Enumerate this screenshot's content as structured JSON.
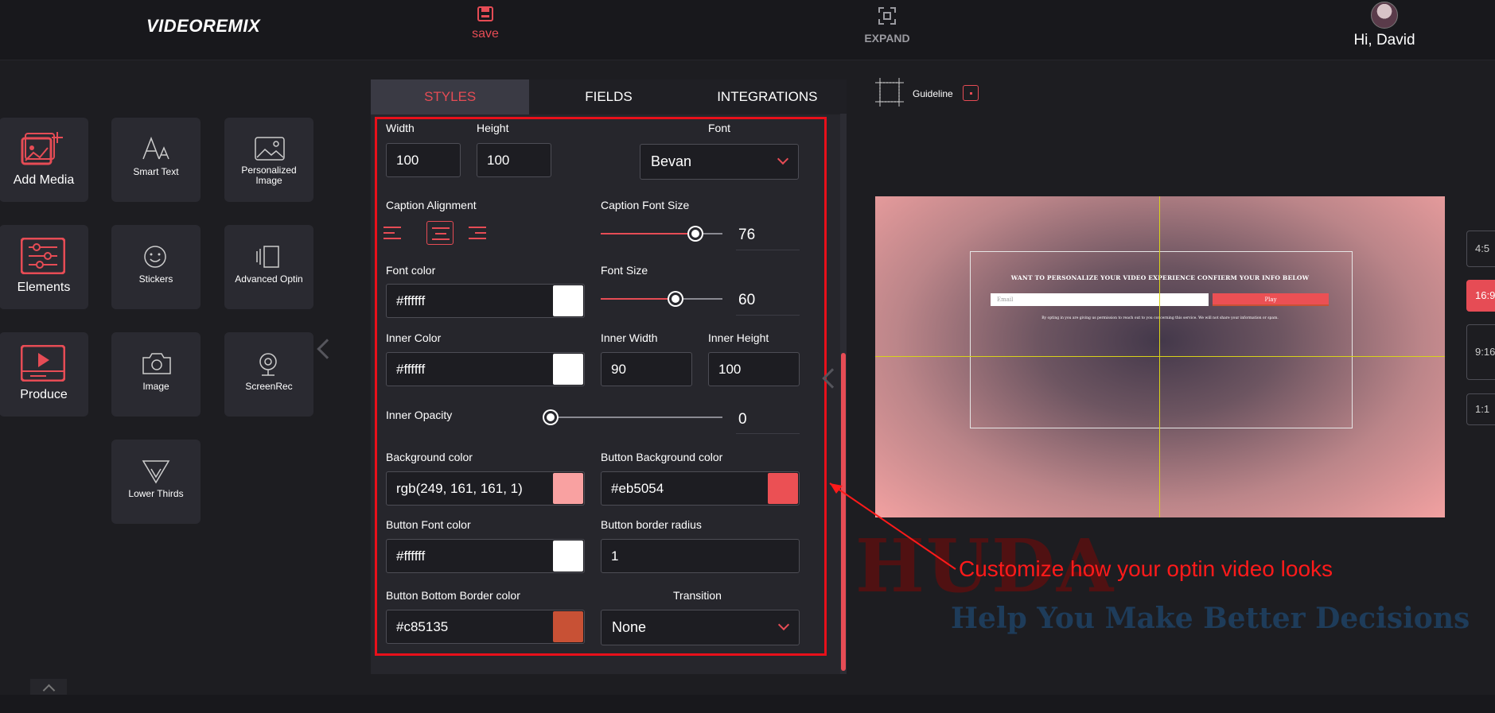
{
  "header": {
    "logo": "VIDEOREMIX",
    "save_label": "save",
    "expand_label": "EXPAND",
    "greeting": "Hi, David"
  },
  "media_menu": [
    {
      "label": "Add Media",
      "icon": "add-media-icon"
    },
    {
      "label": "Elements",
      "icon": "elements-icon"
    },
    {
      "label": "Produce",
      "icon": "produce-icon"
    }
  ],
  "tools": [
    {
      "label": "Smart Text",
      "icon": "smart-text-icon"
    },
    {
      "label": "Personalized Image",
      "icon": "personalized-image-icon"
    },
    {
      "label": "Stickers",
      "icon": "stickers-icon"
    },
    {
      "label": "Advanced Optin",
      "icon": "advanced-optin-icon"
    },
    {
      "label": "Image",
      "icon": "camera-icon"
    },
    {
      "label": "ScreenRec",
      "icon": "webcam-icon"
    },
    {
      "label": "Lower Thirds",
      "icon": "lower-thirds-icon"
    }
  ],
  "panel": {
    "tabs": [
      "STYLES",
      "FIELDS",
      "INTEGRATIONS"
    ],
    "active_tab": "STYLES",
    "labels": {
      "width": "Width",
      "height": "Height",
      "font": "Font",
      "caption_alignment": "Caption Alignment",
      "caption_font_size": "Caption Font Size",
      "font_color": "Font color",
      "font_size": "Font Size",
      "inner_color": "Inner Color",
      "inner_width": "Inner Width",
      "inner_height": "Inner Height",
      "inner_opacity": "Inner Opacity",
      "background_color": "Background color",
      "button_background_color": "Button Background color",
      "button_font_color": "Button Font color",
      "button_border_radius": "Button border radius",
      "button_bottom_border_color": "Button Bottom Border color",
      "transition": "Transition"
    },
    "values": {
      "width": "100",
      "height": "100",
      "font": "Bevan",
      "caption_alignment": "center",
      "caption_font_size": "76",
      "font_color": "#ffffff",
      "font_size": "60",
      "inner_color": "#ffffff",
      "inner_width": "90",
      "inner_height": "100",
      "inner_opacity": "0",
      "background_color": "rgb(249, 161, 161, 1)",
      "button_background_color": "#eb5054",
      "button_font_color": "#ffffff",
      "button_border_radius": "1",
      "button_bottom_border_color": "#c85135",
      "transition": "None"
    },
    "swatches": {
      "font_color": "#ffffff",
      "inner_color": "#ffffff",
      "background_color": "#f9a1a1",
      "button_background_color": "#eb5054",
      "button_font_color": "#ffffff",
      "button_bottom_border_color": "#c85135"
    }
  },
  "guideline": {
    "label": "Guideline"
  },
  "preview": {
    "title": "WANT TO PERSONALIZE YOUR VIDEO EXPERIENCE CONFIERM YOUR INFO BELOW",
    "email_placeholder": "Email",
    "button_label": "Play",
    "note": "By opting in you are giving us permission to reach out to you concerning this service. We will not share your information or spam."
  },
  "aspect_ratios": [
    "4:5",
    "16:9",
    "9:16",
    "1:1"
  ],
  "active_ratio": "16:9",
  "annotation": "Customize how your optin video looks",
  "watermark": {
    "brand": "HUDA",
    "tagline": "Help You Make Better Decisions"
  },
  "colors": {
    "accent": "#e64c55",
    "annotation": "#ff1a1a"
  }
}
